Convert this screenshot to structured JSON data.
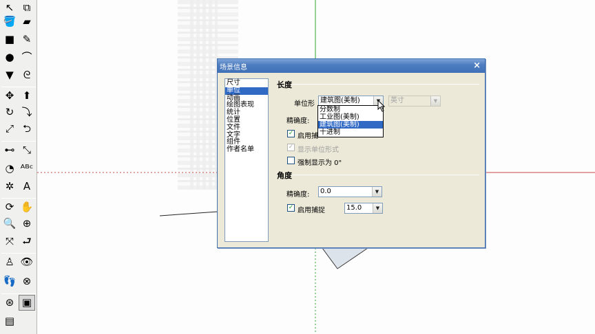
{
  "dialog": {
    "title": "场景信息",
    "close": "×",
    "categories": [
      "尺寸",
      "单位",
      "动画",
      "绘图表现",
      "统计",
      "位置",
      "文件",
      "文字",
      "组件",
      "作者名单"
    ],
    "length": {
      "heading": "长度",
      "format_label": "单位形",
      "format_value": "建筑图(美制)",
      "unit_value": "英寸",
      "format_options": [
        "分数制",
        "工业图(美制)",
        "建筑图(美制)",
        "十进制"
      ],
      "precision_label": "精确度:",
      "snap_label": "启用捕",
      "show_units_label": "显示单位形式",
      "force_label": "强制显示为 0\""
    },
    "angle": {
      "heading": "角度",
      "precision_label": "精确度:",
      "precision_value": "0.0",
      "snap_label": "启用捕捉",
      "snap_value": "15.0"
    },
    "checks": {
      "length_snap": true,
      "show_units": true,
      "force": false,
      "angle_snap": true
    },
    "check_mark": "✓",
    "arrow": "▼"
  },
  "toolbar": {
    "icons": [
      {
        "name": "select-arrow-icon",
        "glyph": "↖"
      },
      {
        "name": "make-component-icon",
        "glyph": "⧉"
      },
      {
        "name": "paint-bucket-icon",
        "glyph": "🪣"
      },
      {
        "name": "eraser-icon",
        "glyph": "▰"
      },
      {
        "name": "rectangle-icon",
        "glyph": "■"
      },
      {
        "name": "pencil-line-icon",
        "glyph": "✎"
      },
      {
        "name": "circle-icon",
        "glyph": "●"
      },
      {
        "name": "arc-icon",
        "glyph": "⌒"
      },
      {
        "name": "polygon-icon",
        "glyph": "▼"
      },
      {
        "name": "freehand-icon",
        "glyph": "ᘓ"
      },
      {
        "name": "move-icon",
        "glyph": "✥"
      },
      {
        "name": "push-pull-icon",
        "glyph": "⬆"
      },
      {
        "name": "rotate-icon",
        "glyph": "↻"
      },
      {
        "name": "follow-me-icon",
        "glyph": "⤵"
      },
      {
        "name": "scale-icon",
        "glyph": "⤢"
      },
      {
        "name": "offset-icon",
        "glyph": "⮌"
      },
      {
        "name": "tape-measure-icon",
        "glyph": "⊷"
      },
      {
        "name": "dimension-icon",
        "glyph": "⤡"
      },
      {
        "name": "protractor-icon",
        "glyph": "◔"
      },
      {
        "name": "text-icon",
        "glyph": "ᴬᴮᶜ"
      },
      {
        "name": "axes-icon",
        "glyph": "✲"
      },
      {
        "name": "3d-text-icon",
        "glyph": "A"
      },
      {
        "name": "orbit-icon",
        "glyph": "⟳"
      },
      {
        "name": "pan-hand-icon",
        "glyph": "✋"
      },
      {
        "name": "zoom-icon",
        "glyph": "🔍"
      },
      {
        "name": "zoom-window-icon",
        "glyph": "⊕"
      },
      {
        "name": "zoom-extents-icon",
        "glyph": "⤧"
      },
      {
        "name": "previous-view-icon",
        "glyph": "⮐"
      },
      {
        "name": "position-camera-icon",
        "glyph": "♙"
      },
      {
        "name": "look-around-icon",
        "glyph": "👁"
      },
      {
        "name": "walk-icon",
        "glyph": "👣"
      },
      {
        "name": "section-plane-icon",
        "glyph": "⊗"
      },
      {
        "name": "compass-icon",
        "glyph": "⊛"
      },
      {
        "name": "section-display-icon",
        "glyph": "▣"
      },
      {
        "name": "section-cut-icon",
        "glyph": "▤"
      }
    ]
  },
  "colors": {
    "axis_green": "#2aa52a",
    "axis_red": "#c84848",
    "selection_blue": "#316ac5",
    "title_blue": "#4f7fc2"
  }
}
